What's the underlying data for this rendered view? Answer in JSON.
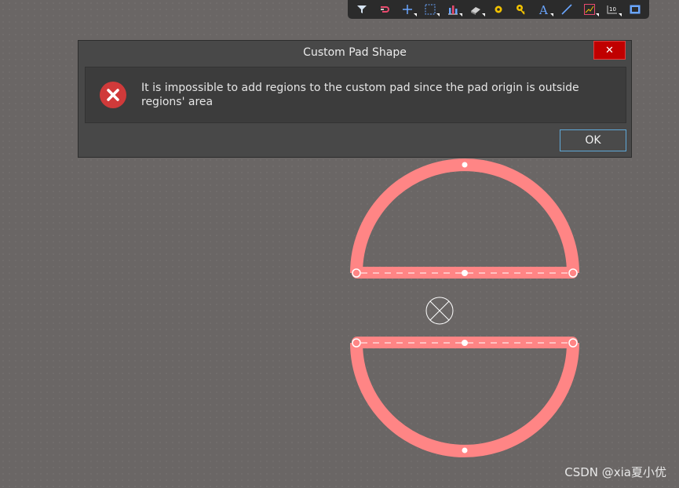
{
  "toolbar": {
    "items": [
      {
        "icon": "filter-icon",
        "dropdown": false
      },
      {
        "icon": "route-icon",
        "dropdown": false
      },
      {
        "icon": "crosshair-icon",
        "dropdown": true
      },
      {
        "icon": "select-rect-icon",
        "dropdown": true
      },
      {
        "icon": "align-icon",
        "dropdown": true
      },
      {
        "icon": "eraser-icon",
        "dropdown": true
      },
      {
        "icon": "via-icon",
        "dropdown": false
      },
      {
        "icon": "key-icon",
        "dropdown": false
      },
      {
        "icon": "text-icon",
        "dropdown": true
      },
      {
        "icon": "line-icon",
        "dropdown": false
      },
      {
        "icon": "graph-icon",
        "dropdown": true
      },
      {
        "icon": "dimension-icon",
        "dropdown": true
      },
      {
        "icon": "board-icon",
        "dropdown": false
      }
    ]
  },
  "dialog": {
    "title": "Custom Pad Shape",
    "close_glyph": "✕",
    "message": "It is impossible to add regions to the custom pad since the pad origin is outside regions' area",
    "ok_label": "OK"
  },
  "colors": {
    "region": "#ff8585",
    "error": "#d03a3a",
    "close": "#c00000"
  },
  "watermark": "CSDN @xia夏小优"
}
